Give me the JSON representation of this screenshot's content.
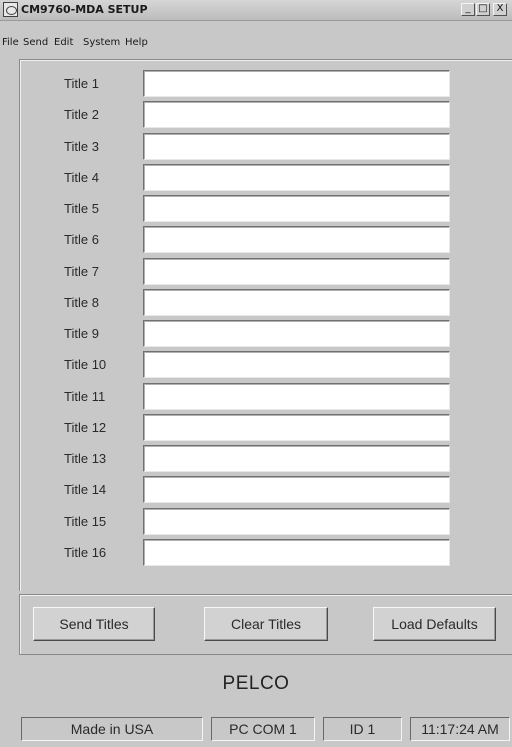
{
  "window": {
    "title": "CM9760-MDA SETUP",
    "controls": {
      "minimize": "_",
      "maximize": "□",
      "close": "X"
    }
  },
  "menu": [
    "File",
    "Send",
    "Edit",
    "System",
    "Help"
  ],
  "titles": [
    {
      "label": "Title 1",
      "value": ""
    },
    {
      "label": "Title 2",
      "value": ""
    },
    {
      "label": "Title 3",
      "value": ""
    },
    {
      "label": "Title 4",
      "value": ""
    },
    {
      "label": "Title 5",
      "value": ""
    },
    {
      "label": "Title 6",
      "value": ""
    },
    {
      "label": "Title 7",
      "value": ""
    },
    {
      "label": "Title 8",
      "value": ""
    },
    {
      "label": "Title 9",
      "value": ""
    },
    {
      "label": "Title 10",
      "value": ""
    },
    {
      "label": "Title 11",
      "value": ""
    },
    {
      "label": "Title 12",
      "value": ""
    },
    {
      "label": "Title 13",
      "value": ""
    },
    {
      "label": "Title 14",
      "value": ""
    },
    {
      "label": "Title 15",
      "value": ""
    },
    {
      "label": "Title 16",
      "value": ""
    }
  ],
  "buttons": {
    "send": "Send Titles",
    "clear": "Clear Titles",
    "load": "Load Defaults"
  },
  "brand": "PELCO",
  "status": {
    "origin": "Made in USA",
    "port": "PC COM 1",
    "id": "ID 1",
    "time": "11:17:24 AM"
  }
}
